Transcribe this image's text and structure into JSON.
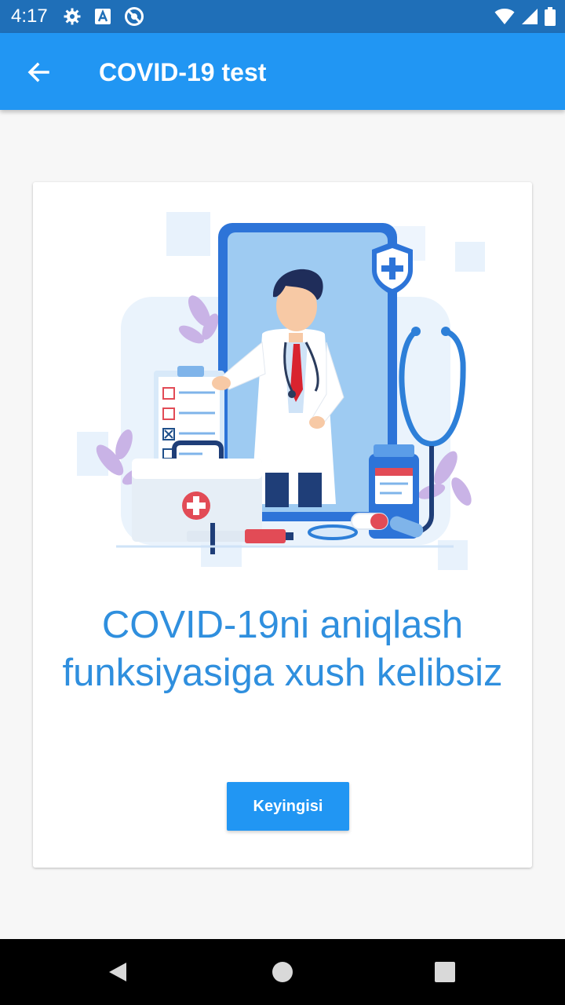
{
  "status_bar": {
    "time": "4:17",
    "left_icons": [
      "settings-icon",
      "font-a-icon",
      "do-not-disturb-icon"
    ],
    "right_icons": [
      "wifi-icon",
      "signal-icon",
      "battery-icon"
    ]
  },
  "app_bar": {
    "title": "COVID-19 test",
    "back_icon": "arrow-back-icon",
    "color": "#2196f3"
  },
  "card": {
    "illustration": "doctor-on-phone-illustration",
    "welcome_text": "COVID-19ni aniqlash funksiyasiga xush kelibsiz",
    "next_button_label": "Keyingisi",
    "text_color": "#2f8fde"
  },
  "nav_bar": {
    "buttons": [
      "back-triangle-icon",
      "home-circle-icon",
      "recents-square-icon"
    ]
  }
}
